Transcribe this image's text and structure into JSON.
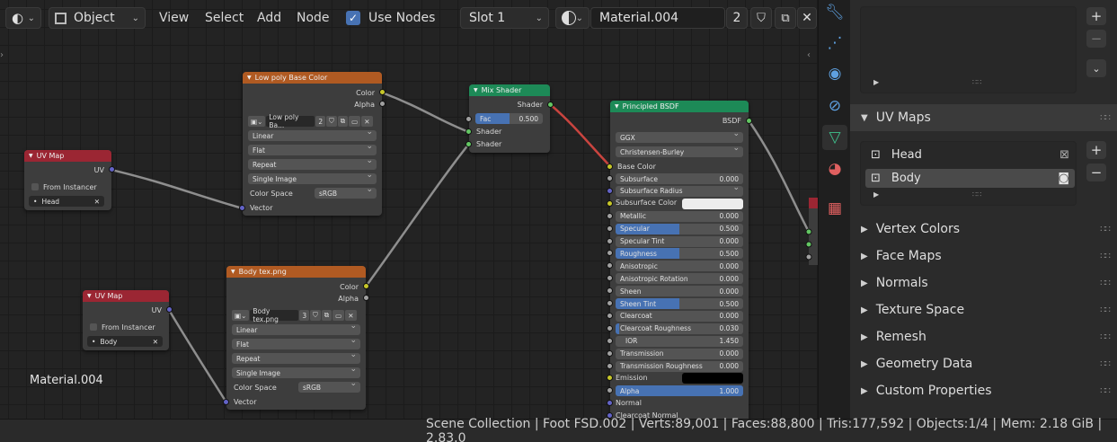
{
  "header": {
    "mode": "Object",
    "menus": [
      "View",
      "Select",
      "Add",
      "Node"
    ],
    "use_nodes_label": "Use Nodes",
    "slot": "Slot 1",
    "material": "Material.004",
    "users": "2"
  },
  "editor": {
    "material_label": "Material.004"
  },
  "nodes": {
    "uvmap1": {
      "title": "UV Map",
      "output": "UV",
      "from_instancer": "From Instancer",
      "uv_name": "Head"
    },
    "uvmap2": {
      "title": "UV Map",
      "output": "UV",
      "from_instancer": "From Instancer",
      "uv_name": "Body"
    },
    "tex1": {
      "title": "Low poly Base Color",
      "out_color": "Color",
      "out_alpha": "Alpha",
      "image": "Low poly Ba...",
      "users": "2",
      "interpolation": "Linear",
      "projection": "Flat",
      "extension": "Repeat",
      "source": "Single Image",
      "colorspace_label": "Color Space",
      "colorspace": "sRGB",
      "in_vector": "Vector"
    },
    "tex2": {
      "title": "Body tex.png",
      "out_color": "Color",
      "out_alpha": "Alpha",
      "image": "Body tex.png",
      "users": "3",
      "interpolation": "Linear",
      "projection": "Flat",
      "extension": "Repeat",
      "source": "Single Image",
      "colorspace_label": "Color Space",
      "colorspace": "sRGB",
      "in_vector": "Vector"
    },
    "mix": {
      "title": "Mix Shader",
      "out": "Shader",
      "fac_label": "Fac",
      "fac": "0.500",
      "fac_fraction": 0.5,
      "in1": "Shader",
      "in2": "Shader"
    },
    "bsdf": {
      "title": "Principled BSDF",
      "out": "BSDF",
      "distribution": "GGX",
      "subsurface_method": "Christensen-Burley",
      "base_color": "Base Color",
      "rows": [
        {
          "label": "Subsurface",
          "value": "0.000",
          "fill": 0
        },
        {
          "label": "Subsurface Radius",
          "value": "",
          "fill": 0
        },
        {
          "label": "Subsurface Color",
          "value": "",
          "fill": 0
        },
        {
          "label": "Metallic",
          "value": "0.000",
          "fill": 0
        },
        {
          "label": "Specular",
          "value": "0.500",
          "fill": 0.5
        },
        {
          "label": "Specular Tint",
          "value": "0.000",
          "fill": 0
        },
        {
          "label": "Roughness",
          "value": "0.500",
          "fill": 0.5
        },
        {
          "label": "Anisotropic",
          "value": "0.000",
          "fill": 0
        },
        {
          "label": "Anisotropic Rotation",
          "value": "0.000",
          "fill": 0
        },
        {
          "label": "Sheen",
          "value": "0.000",
          "fill": 0
        },
        {
          "label": "Sheen Tint",
          "value": "0.500",
          "fill": 0.5
        },
        {
          "label": "Clearcoat",
          "value": "0.000",
          "fill": 0
        },
        {
          "label": "Clearcoat Roughness",
          "value": "0.030",
          "fill": 0.03
        },
        {
          "label": "IOR",
          "value": "1.450",
          "fill": 0
        },
        {
          "label": "Transmission",
          "value": "0.000",
          "fill": 0
        },
        {
          "label": "Transmission Roughness",
          "value": "0.000",
          "fill": 0
        },
        {
          "label": "Emission",
          "value": "",
          "fill": 0
        },
        {
          "label": "Alpha",
          "value": "1.000",
          "fill": 1
        },
        {
          "label": "Normal",
          "value": "",
          "fill": 0
        },
        {
          "label": "Clearcoat Normal",
          "value": "",
          "fill": 0
        }
      ]
    }
  },
  "properties": {
    "uv_maps_title": "UV Maps",
    "uv_maps": [
      "Head",
      "Body"
    ],
    "panels": [
      "Vertex Colors",
      "Face Maps",
      "Normals",
      "Texture Space",
      "Remesh",
      "Geometry Data",
      "Custom Properties"
    ]
  },
  "status": {
    "text": "Scene Collection | Foot  FSD.002 | Verts:89,001 | Faces:88,800 | Tris:177,592 | Objects:1/4 | Mem: 2.18 GiB | 2.83.0"
  },
  "colors": {
    "accent_blue": "#4772b3",
    "header_red": "#9b2633",
    "header_orange": "#b05a22",
    "header_green": "#1d8a57"
  }
}
